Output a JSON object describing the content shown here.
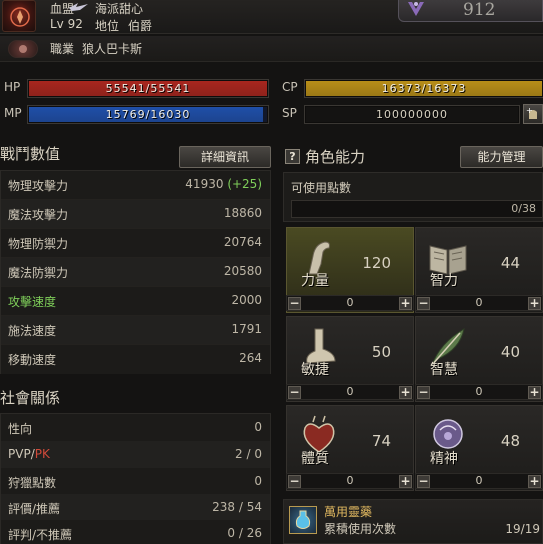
{
  "header": {
    "pledge_name": "血盟",
    "clan_name": "海派甜心",
    "level": "Lv 92",
    "title_label": "地位",
    "title_value": "伯爵",
    "rank_value": "912"
  },
  "class_row": {
    "label": "職業",
    "value": "狼人巴卡斯"
  },
  "bars": {
    "hp_label": "HP",
    "hp_text": "55541/55541",
    "hp_fill": 1.0,
    "hp_color": "#a8261e",
    "mp_label": "MP",
    "mp_text": "15769/16030",
    "mp_fill": 0.984,
    "mp_color": "#1f4fa8",
    "cp_label": "CP",
    "cp_text": "16373/16373",
    "cp_fill": 1.0,
    "cp_color": "#b88e18",
    "sp_label": "SP",
    "sp_text": "100000000"
  },
  "combat": {
    "title": "戰鬥數值",
    "detail_button": "詳細資訊",
    "stats": [
      {
        "name": "物理攻擊力",
        "value": "41930",
        "bonus": "(+25)"
      },
      {
        "name": "魔法攻擊力",
        "value": "18860",
        "bonus": ""
      },
      {
        "name": "物理防禦力",
        "value": "20764",
        "bonus": ""
      },
      {
        "name": "魔法防禦力",
        "value": "20580",
        "bonus": ""
      },
      {
        "name": "攻擊速度",
        "value": "2000",
        "bonus": ""
      },
      {
        "name": "施法速度",
        "value": "1791",
        "bonus": ""
      },
      {
        "name": "移動速度",
        "value": "264",
        "bonus": ""
      }
    ]
  },
  "social": {
    "title": "社會關係",
    "rows": [
      {
        "name": "性向",
        "value": "0"
      },
      {
        "name_pvp": "PVP",
        "name_sep": "/",
        "name_pk": "PK",
        "value": "2 / 0"
      },
      {
        "name": "狩獵點數",
        "value": "0"
      },
      {
        "name": "評價/推薦",
        "value": "238 / 54"
      },
      {
        "name": "評判/不推薦",
        "value": "0 / 26"
      }
    ]
  },
  "ability": {
    "title": "角色能力",
    "help_glyph": "?",
    "manage_button": "能力管理",
    "points_label": "可使用點數",
    "points_value": "0/38",
    "tiles": [
      {
        "name": "力量",
        "value": "120",
        "alloc": "0",
        "icon": "arm-icon"
      },
      {
        "name": "智力",
        "value": "44",
        "alloc": "0",
        "icon": "book-icon"
      },
      {
        "name": "敏捷",
        "value": "50",
        "alloc": "0",
        "icon": "foot-icon"
      },
      {
        "name": "智慧",
        "value": "40",
        "alloc": "0",
        "icon": "feather-icon"
      },
      {
        "name": "體質",
        "value": "74",
        "alloc": "0",
        "icon": "heart-icon"
      },
      {
        "name": "精神",
        "value": "48",
        "alloc": "0",
        "icon": "head-icon"
      }
    ],
    "plus": "+",
    "minus": "−"
  },
  "potion": {
    "name": "萬用靈藥",
    "usage_label": "累積使用次數",
    "usage_value": "19/19"
  }
}
